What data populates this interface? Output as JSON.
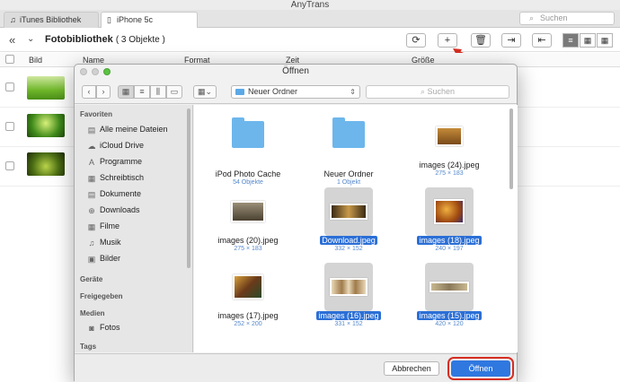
{
  "app": {
    "title": "AnyTrans"
  },
  "tabs": [
    {
      "label": "iTunes Bibliothek",
      "icon": "music-icon"
    },
    {
      "label": "iPhone 5c",
      "icon": "phone-icon"
    }
  ],
  "search_main": {
    "placeholder": "Suchen"
  },
  "toolbar": {
    "title": "Fotobibliothek",
    "count": "( 3 Objekte )"
  },
  "columns": [
    "Bild",
    "Name",
    "Format",
    "Zeit",
    "Größe"
  ],
  "dialog": {
    "title": "Öffnen",
    "folder": "Neuer Ordner",
    "search_placeholder": "Suchen",
    "sidebar": {
      "favoriten": "Favoriten",
      "items": [
        "Alle meine Dateien",
        "iCloud Drive",
        "Programme",
        "Schreibtisch",
        "Dokumente",
        "Downloads",
        "Filme",
        "Musik",
        "Bilder"
      ],
      "geraete": "Geräte",
      "freigegeben": "Freigegeben",
      "medien": "Medien",
      "fotos": "Fotos",
      "tags": "Tags"
    },
    "files": [
      {
        "name": "iPod Photo Cache",
        "meta": "54 Objekte",
        "kind": "folder",
        "selected": false
      },
      {
        "name": "Neuer Ordner",
        "meta": "1 Objekt",
        "kind": "folder",
        "selected": false
      },
      {
        "name": "images (24).jpeg",
        "meta": "275 × 183",
        "kind": "image",
        "selected": false
      },
      {
        "name": "images (20).jpeg",
        "meta": "275 × 183",
        "kind": "image",
        "selected": false
      },
      {
        "name": "Download.jpeg",
        "meta": "332 × 152",
        "kind": "image",
        "selected": true
      },
      {
        "name": "images (18).jpeg",
        "meta": "240 × 197",
        "kind": "image",
        "selected": true
      },
      {
        "name": "images (17).jpeg",
        "meta": "252 × 200",
        "kind": "image",
        "selected": false
      },
      {
        "name": "images (16).jpeg",
        "meta": "331 × 152",
        "kind": "image",
        "selected": true
      },
      {
        "name": "images (15).jpeg",
        "meta": "420 × 120",
        "kind": "image",
        "selected": true
      }
    ],
    "cancel_label": "Abbrechen",
    "open_label": "Öffnen"
  },
  "colors": {
    "accent": "#2f78e0",
    "highlight": "#d62e22",
    "folder": "#6cb6ec"
  }
}
